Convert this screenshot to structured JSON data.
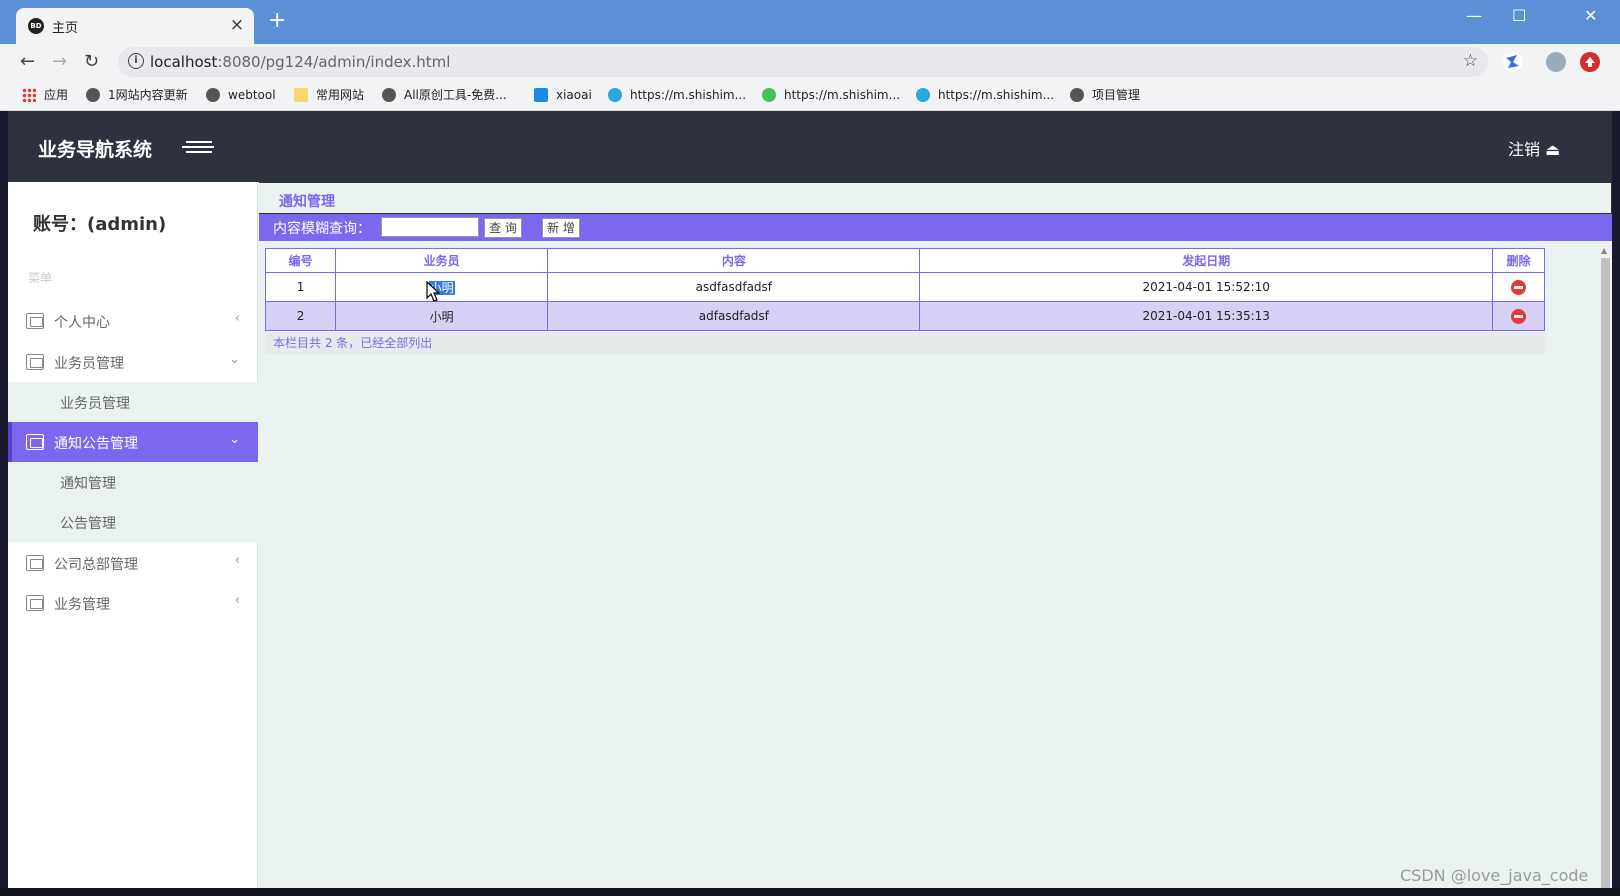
{
  "browser": {
    "tab_favicon": "BD",
    "tab_title": "主页",
    "tab_close": "×",
    "new_tab": "+",
    "url_host": "localhost",
    "url_path": ":8080/pg124/admin/index.html",
    "window_buttons": [
      "—",
      "☐",
      "✕"
    ],
    "bookmarks": [
      {
        "label": "应用",
        "icon": "apps-grid-icon"
      },
      {
        "label": "1网站内容更新",
        "icon": "globe-icon"
      },
      {
        "label": "webtool",
        "icon": "globe-icon"
      },
      {
        "label": "常用网站",
        "icon": "folder-icon"
      },
      {
        "label": "All原创工具-免费...",
        "icon": "globe-icon"
      },
      {
        "label": "xiaoai",
        "icon": "p-logo-icon"
      },
      {
        "label": "https://m.shishim...",
        "icon": "site-icon"
      },
      {
        "label": "https://m.shishim...",
        "icon": "wechat-icon"
      },
      {
        "label": "https://m.shishim...",
        "icon": "site-icon"
      },
      {
        "label": "项目管理",
        "icon": "globe-icon"
      }
    ]
  },
  "header": {
    "brand": "业务导航系统",
    "logout": "注销 ⏏"
  },
  "sidebar": {
    "account": "账号：(admin)",
    "caption": "菜单",
    "menu": [
      {
        "label": "个人中心",
        "arrow": "‹"
      },
      {
        "label": "业务员管理",
        "arrow": "⌄"
      },
      {
        "label": "通知公告管理",
        "arrow": "⌄"
      },
      {
        "label": "公司总部管理",
        "arrow": "‹"
      },
      {
        "label": "业务管理",
        "arrow": "‹"
      }
    ],
    "sub_salesman": [
      "业务员管理"
    ],
    "sub_notice": [
      "通知管理",
      "公告管理"
    ]
  },
  "content": {
    "title": "通知管理",
    "search_label": "内容模糊查询：",
    "search_value": "",
    "query_button": "查 询",
    "add_button": "新 增",
    "columns": [
      "编号",
      "业务员",
      "内容",
      "发起日期",
      "删除"
    ],
    "rows": [
      {
        "id": "1",
        "salesman": "小明",
        "content": "asdfasdfadsf",
        "date": "2021-04-01 15:52:10"
      },
      {
        "id": "2",
        "salesman": "小明",
        "content": "adfasdfadsf",
        "date": "2021-04-01 15:35:13"
      }
    ],
    "footer": "本栏目共 2 条，已经全部列出"
  },
  "watermark": "CSDN @love_java_code",
  "colors": {
    "accent": "#7b68ee",
    "header_bg": "#2e323e",
    "tabbar": "#5b8fd6",
    "delete": "#e53935"
  }
}
